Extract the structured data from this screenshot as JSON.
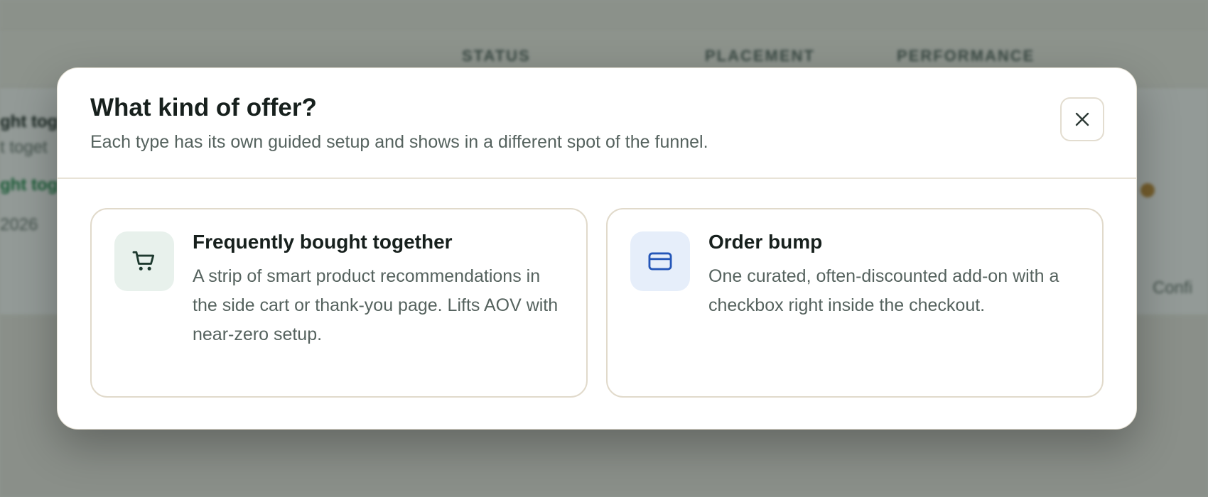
{
  "background": {
    "columns": [
      "STATUS",
      "PLACEMENT",
      "PERFORMANCE"
    ],
    "fragments": [
      "ght tog",
      "t toget",
      "ght tog",
      "2026",
      "Confi"
    ]
  },
  "modal": {
    "title": "What kind of offer?",
    "subtitle": "Each type has its own guided setup and shows in a different spot of the funnel.",
    "close_icon": "close-icon",
    "options": [
      {
        "icon": "cart-icon",
        "title": "Frequently bought together",
        "description": "A strip of smart product recommendations in the side cart or thank-you page. Lifts AOV with near-zero setup.",
        "icon_color": "#1e3a2f",
        "icon_bg": "#e8f1ec"
      },
      {
        "icon": "credit-card-icon",
        "title": "Order bump",
        "description": "One curated, often-discounted add-on with a checkbox right inside the checkout.",
        "icon_color": "#2456b8",
        "icon_bg": "#e6eefa"
      }
    ]
  }
}
